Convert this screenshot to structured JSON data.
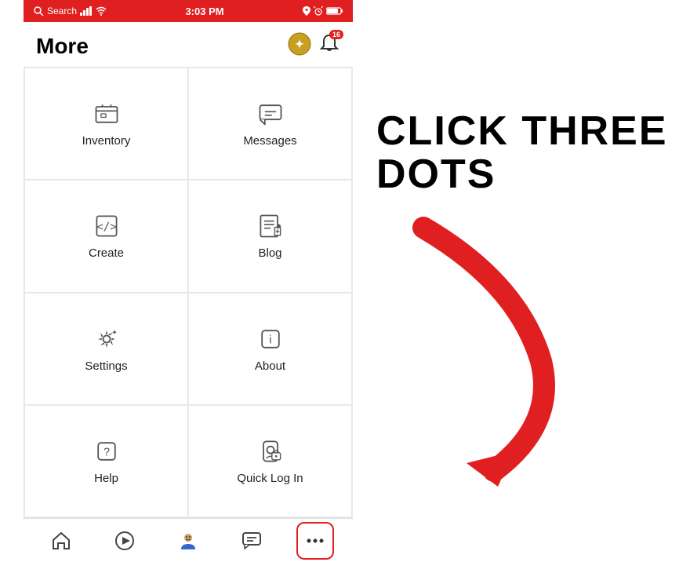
{
  "statusBar": {
    "left": "Search",
    "time": "3:03 PM",
    "notificationBadge": "16"
  },
  "header": {
    "title": "More"
  },
  "menuItems": [
    {
      "id": "inventory",
      "label": "Inventory",
      "icon": "inventory"
    },
    {
      "id": "messages",
      "label": "Messages",
      "icon": "messages"
    },
    {
      "id": "create",
      "label": "Create",
      "icon": "create"
    },
    {
      "id": "blog",
      "label": "Blog",
      "icon": "blog"
    },
    {
      "id": "settings",
      "label": "Settings",
      "icon": "settings"
    },
    {
      "id": "about",
      "label": "About",
      "icon": "about"
    },
    {
      "id": "help",
      "label": "Help",
      "icon": "help"
    },
    {
      "id": "quicklogin",
      "label": "Quick Log In",
      "icon": "quicklogin"
    }
  ],
  "bottomNav": [
    {
      "id": "home",
      "label": "Home",
      "icon": "home"
    },
    {
      "id": "play",
      "label": "Play",
      "icon": "play"
    },
    {
      "id": "avatar",
      "label": "Avatar",
      "icon": "avatar"
    },
    {
      "id": "chat",
      "label": "Chat",
      "icon": "chat"
    },
    {
      "id": "more",
      "label": "More",
      "icon": "more",
      "active": true
    }
  ],
  "annotation": {
    "text": "CLICK THREE DOTS"
  }
}
